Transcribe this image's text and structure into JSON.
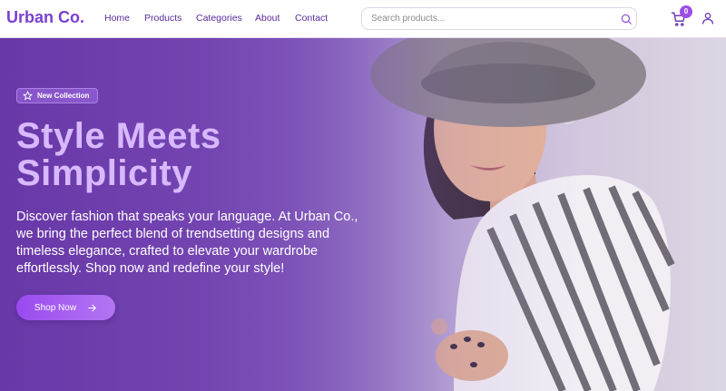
{
  "brand": {
    "name": "Urban Co."
  },
  "nav": {
    "links": [
      {
        "label": "Home"
      },
      {
        "label": "Products"
      },
      {
        "label": "Categories"
      },
      {
        "label": "About"
      },
      {
        "label": "Contact"
      }
    ]
  },
  "search": {
    "placeholder": "Search products...",
    "value": ""
  },
  "cart": {
    "count": "0"
  },
  "icons": {
    "search": "search-icon",
    "cart": "cart-icon",
    "user": "user-icon",
    "badge": "star-icon",
    "button": "arrow-right-icon"
  },
  "hero": {
    "badge": "New Collection",
    "title_line1": "Style Meets",
    "title_line2": "Simplicity",
    "description": "Discover fashion that speaks your language. At Urban Co., we bring the perfect blend of trendsetting designs and timeless elegance, crafted to elevate your wardrobe effortlessly. Shop now and redefine your style!",
    "cta": "Shop Now"
  },
  "colors": {
    "brand": "#7a3fd1",
    "nav_text": "#5a2a9a",
    "hero_title": "#d8b8ff",
    "accent": "#9b4de6"
  }
}
